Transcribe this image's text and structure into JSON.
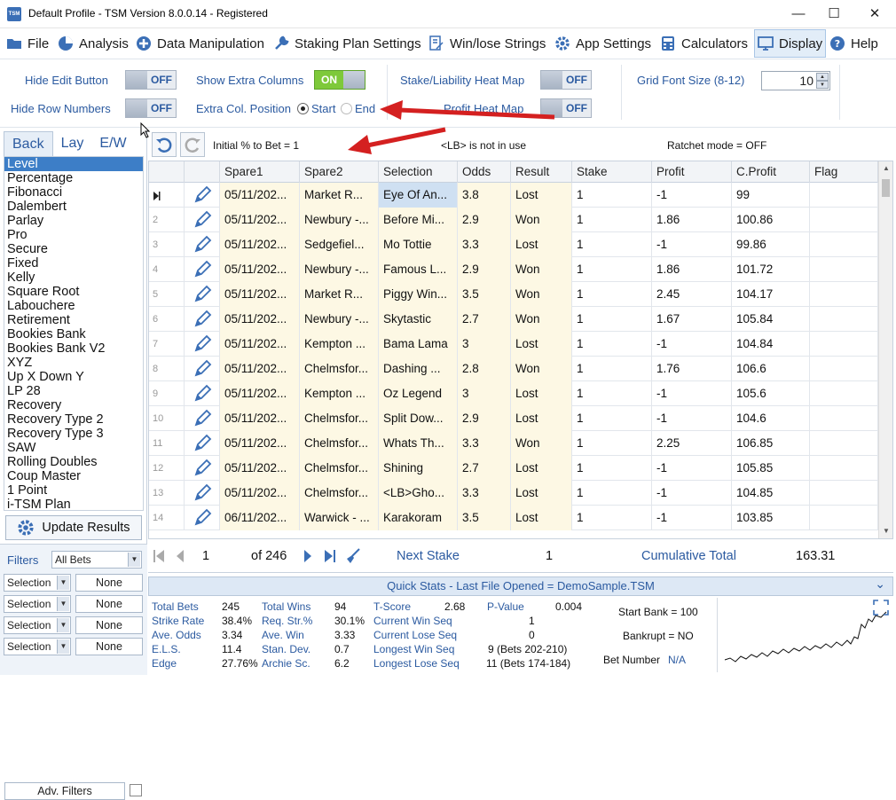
{
  "window": {
    "logo_text": "TSM",
    "title": "Default Profile  -  TSM Version 8.0.0.14 - Registered",
    "controls": {
      "minimize": "—",
      "maximize": "☐",
      "close": "✕"
    }
  },
  "menu": [
    {
      "label": "File",
      "icon": "folder-icon"
    },
    {
      "label": "Analysis",
      "icon": "pie-chart-icon"
    },
    {
      "label": "Data Manipulation",
      "icon": "plus-circle-icon"
    },
    {
      "label": "Staking Plan Settings",
      "icon": "wrench-icon"
    },
    {
      "label": "Win/lose Strings",
      "icon": "document-pen-icon"
    },
    {
      "label": "App Settings",
      "icon": "gear-icon"
    },
    {
      "label": "Calculators",
      "icon": "calculator-icon"
    },
    {
      "label": "Display",
      "icon": "monitor-icon",
      "active": true
    },
    {
      "label": "Help",
      "icon": "help-icon"
    }
  ],
  "options": {
    "hide_edit_button": {
      "label": "Hide Edit Button",
      "value": "OFF"
    },
    "hide_row_numbers": {
      "label": "Hide Row Numbers",
      "value": "OFF"
    },
    "show_extra_columns": {
      "label": "Show Extra Columns",
      "value": "ON"
    },
    "extra_col_position": {
      "label": "Extra Col. Position",
      "start": "Start",
      "end": "End",
      "selected": "Start"
    },
    "heat_map": {
      "label": "Stake/Liability Heat Map",
      "value": "OFF"
    },
    "profit_heat_map": {
      "label": "Profit Heat Map",
      "value": "OFF"
    },
    "grid_font_size": {
      "label": "Grid Font Size (8-12)",
      "value": "10"
    }
  },
  "left": {
    "tabs": [
      "Back",
      "Lay",
      "E/W"
    ],
    "active_tab": "Back",
    "plans": [
      "Level",
      "Percentage",
      "Fibonacci",
      "Dalembert",
      "Parlay",
      "Pro",
      "Secure",
      "Fixed",
      "Kelly",
      "Square Root",
      "Labouchere",
      "Retirement",
      "Bookies Bank",
      "Bookies Bank V2",
      "XYZ",
      "Up X Down Y",
      "LP 28",
      "Recovery",
      "Recovery Type 2",
      "Recovery Type 3",
      "SAW",
      "Rolling Doubles",
      "Coup Master",
      "1 Point",
      "i-TSM Plan"
    ],
    "selected_plan": "Level",
    "update_button": "Update Results",
    "filters_label": "Filters",
    "filters_value": "All Bets",
    "filter_rows": [
      {
        "field": "Selection",
        "value": "None"
      },
      {
        "field": "Selection",
        "value": "None"
      },
      {
        "field": "Selection",
        "value": "None"
      },
      {
        "field": "Selection",
        "value": "None"
      }
    ],
    "adv_filters": "Adv. Filters"
  },
  "grid_toolbar": {
    "initial_pct": "Initial % to Bet = 1",
    "lb_status": "<LB> is not in use",
    "ratchet": "Ratchet mode = OFF"
  },
  "grid": {
    "columns": [
      "Spare1",
      "Spare2",
      "Selection",
      "Odds",
      "Result",
      "Stake",
      "Profit",
      "C.Profit",
      "Flag"
    ],
    "rows": [
      {
        "num": "",
        "spare1": "05/11/202...",
        "spare2": "Market R...",
        "selection": "Eye Of An...",
        "odds": "3.8",
        "result": "Lost",
        "stake": "1",
        "profit": "-1",
        "cprofit": "99"
      },
      {
        "num": "2",
        "spare1": "05/11/202...",
        "spare2": "Newbury -...",
        "selection": "Before Mi...",
        "odds": "2.9",
        "result": "Won",
        "stake": "1",
        "profit": "1.86",
        "cprofit": "100.86"
      },
      {
        "num": "3",
        "spare1": "05/11/202...",
        "spare2": "Sedgefiel...",
        "selection": "Mo Tottie",
        "odds": "3.3",
        "result": "Lost",
        "stake": "1",
        "profit": "-1",
        "cprofit": "99.86"
      },
      {
        "num": "4",
        "spare1": "05/11/202...",
        "spare2": "Newbury -...",
        "selection": "Famous L...",
        "odds": "2.9",
        "result": "Won",
        "stake": "1",
        "profit": "1.86",
        "cprofit": "101.72"
      },
      {
        "num": "5",
        "spare1": "05/11/202...",
        "spare2": "Market R...",
        "selection": "Piggy Win...",
        "odds": "3.5",
        "result": "Won",
        "stake": "1",
        "profit": "2.45",
        "cprofit": "104.17"
      },
      {
        "num": "6",
        "spare1": "05/11/202...",
        "spare2": "Newbury -...",
        "selection": "Skytastic",
        "odds": "2.7",
        "result": "Won",
        "stake": "1",
        "profit": "1.67",
        "cprofit": "105.84"
      },
      {
        "num": "7",
        "spare1": "05/11/202...",
        "spare2": "Kempton ...",
        "selection": "Bama Lama",
        "odds": "3",
        "result": "Lost",
        "stake": "1",
        "profit": "-1",
        "cprofit": "104.84"
      },
      {
        "num": "8",
        "spare1": "05/11/202...",
        "spare2": "Chelmsfor...",
        "selection": "Dashing ...",
        "odds": "2.8",
        "result": "Won",
        "stake": "1",
        "profit": "1.76",
        "cprofit": "106.6"
      },
      {
        "num": "9",
        "spare1": "05/11/202...",
        "spare2": "Kempton ...",
        "selection": "Oz Legend",
        "odds": "3",
        "result": "Lost",
        "stake": "1",
        "profit": "-1",
        "cprofit": "105.6"
      },
      {
        "num": "10",
        "spare1": "05/11/202...",
        "spare2": "Chelmsfor...",
        "selection": "Split Dow...",
        "odds": "2.9",
        "result": "Lost",
        "stake": "1",
        "profit": "-1",
        "cprofit": "104.6"
      },
      {
        "num": "11",
        "spare1": "05/11/202...",
        "spare2": "Chelmsfor...",
        "selection": "Whats Th...",
        "odds": "3.3",
        "result": "Won",
        "stake": "1",
        "profit": "2.25",
        "cprofit": "106.85"
      },
      {
        "num": "12",
        "spare1": "05/11/202...",
        "spare2": "Chelmsfor...",
        "selection": "Shining",
        "odds": "2.7",
        "result": "Lost",
        "stake": "1",
        "profit": "-1",
        "cprofit": "105.85"
      },
      {
        "num": "13",
        "spare1": "05/11/202...",
        "spare2": "Chelmsfor...",
        "selection": "<LB>Gho...",
        "odds": "3.3",
        "result": "Lost",
        "stake": "1",
        "profit": "-1",
        "cprofit": "104.85"
      },
      {
        "num": "14",
        "spare1": "06/11/202...",
        "spare2": "Warwick - ...",
        "selection": "Karakoram",
        "odds": "3.5",
        "result": "Lost",
        "stake": "1",
        "profit": "-1",
        "cprofit": "103.85"
      }
    ]
  },
  "nav": {
    "page": "1",
    "of_total": "of 246",
    "next_stake_label": "Next Stake",
    "next_stake_value": "1",
    "cumulative_label": "Cumulative Total",
    "cumulative_value": "163.31"
  },
  "quick_stats": {
    "title": "Quick Stats - Last File Opened = DemoSample.TSM",
    "collapse_glyph": "⌄",
    "col1": [
      {
        "label": "Total Bets",
        "value": "245"
      },
      {
        "label": "Strike Rate",
        "value": "38.4%"
      },
      {
        "label": "Ave. Odds",
        "value": "3.34"
      },
      {
        "label": "E.L.S.",
        "value": "11.4"
      },
      {
        "label": "Edge",
        "value": "27.76%"
      }
    ],
    "col2": [
      {
        "label": "Total Wins",
        "value": "94"
      },
      {
        "label": "Req. Str.%",
        "value": "30.1%"
      },
      {
        "label": "Ave. Win",
        "value": "3.33"
      },
      {
        "label": "Stan. Dev.",
        "value": "0.7"
      },
      {
        "label": "Archie Sc.",
        "value": "6.2"
      }
    ],
    "tscore": {
      "label": "T-Score",
      "value": "2.68"
    },
    "pvalue": {
      "label": "P-Value",
      "value": "0.004"
    },
    "current_win": {
      "label": "Current Win Seq",
      "value": "1"
    },
    "current_lose": {
      "label": "Current Lose Seq",
      "value": "0"
    },
    "longest_win": {
      "label": "Longest Win Seq",
      "value": "9  (Bets 202-210)"
    },
    "longest_lose": {
      "label": "Longest Lose Seq",
      "value": "11  (Bets 174-184)"
    },
    "start_bank": "Start Bank = 100",
    "bankrupt": "Bankrupt = NO",
    "bet_number_label": "Bet Number",
    "bet_number_value": "N/A"
  },
  "colors": {
    "accent": "#2b5aa0",
    "selection": "#3d7ec7",
    "toggle_on": "#7ec93a",
    "arrow": "#d42020",
    "cell_tint": "#fdf8e4"
  }
}
